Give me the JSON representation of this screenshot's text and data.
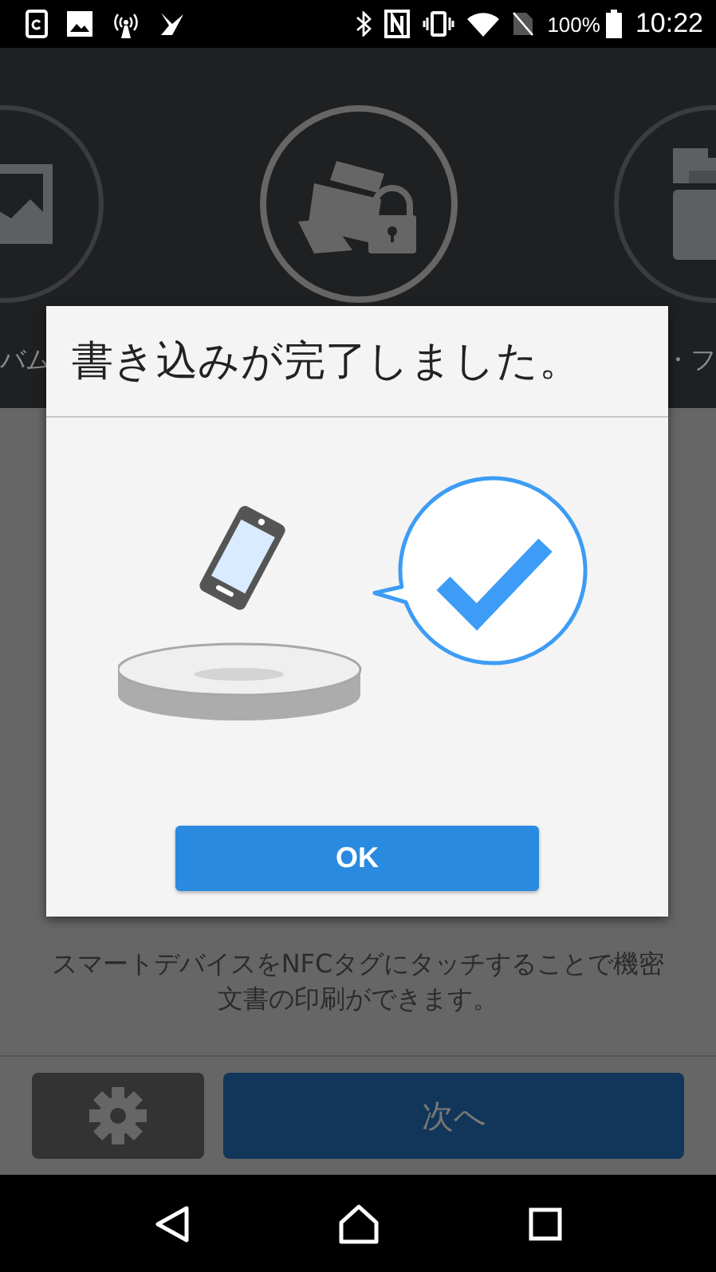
{
  "status_bar": {
    "battery": "100%",
    "time": "10:22"
  },
  "carousel": {
    "items": [
      {
        "kind": "photo",
        "label": "バム"
      },
      {
        "kind": "secure_print"
      },
      {
        "kind": "document",
        "label": "・フ"
      }
    ]
  },
  "description": "スマートデバイスをNFCタグにタッチすることで機密文書の印刷ができます。",
  "bottom_bar": {
    "next_button": "次へ"
  },
  "dialog": {
    "title": "書き込みが完了しました。",
    "ok_button": "OK"
  }
}
